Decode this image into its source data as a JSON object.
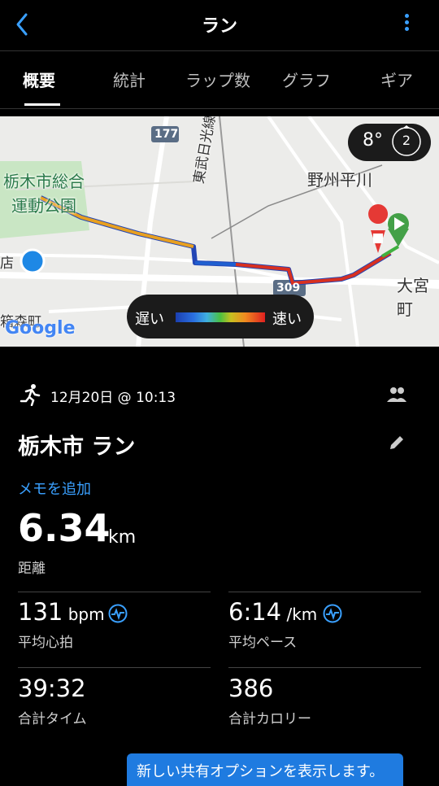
{
  "header": {
    "title": "ラン",
    "back_icon": "chevron-left-icon",
    "more_icon": "more-vertical-icon"
  },
  "tabs": [
    {
      "label": "概要"
    },
    {
      "label": "統計"
    },
    {
      "label": "ラップ数"
    },
    {
      "label": "グラフ"
    },
    {
      "label": "ギア"
    }
  ],
  "map": {
    "temperature": "8°",
    "compass_number": "2",
    "legend_slow": "遅い",
    "legend_fast": "速い",
    "labels": {
      "park_line1": "栃木市総合",
      "park_line2": "運動公園",
      "hirakawa": "野州平川",
      "line_name": "東武日光線",
      "omiya": "大宮町",
      "town": "箱森町",
      "route177": "177",
      "route309": "309",
      "google": "Google",
      "store_char": "店"
    }
  },
  "activity": {
    "date": "12月20日 @ 10:13",
    "title": "栃木市 ラン",
    "memo_link": "メモを追加",
    "distance": {
      "value": "6.34",
      "unit": "km",
      "label": "距離"
    },
    "stats": [
      {
        "value": "131",
        "unit": " bpm",
        "label": "平均心拍"
      },
      {
        "value": "6:14",
        "unit": " /km",
        "label": "平均ペース"
      },
      {
        "value": "39:32",
        "unit": "",
        "label": "合計タイム"
      },
      {
        "value": "386",
        "unit": "",
        "label": "合計カロリー"
      }
    ]
  },
  "banner": {
    "text": "新しい共有オプションを表示します。"
  },
  "colors": {
    "accent": "#3aa0ff",
    "share_bg": "#1f7be0",
    "bg": "#000000"
  }
}
